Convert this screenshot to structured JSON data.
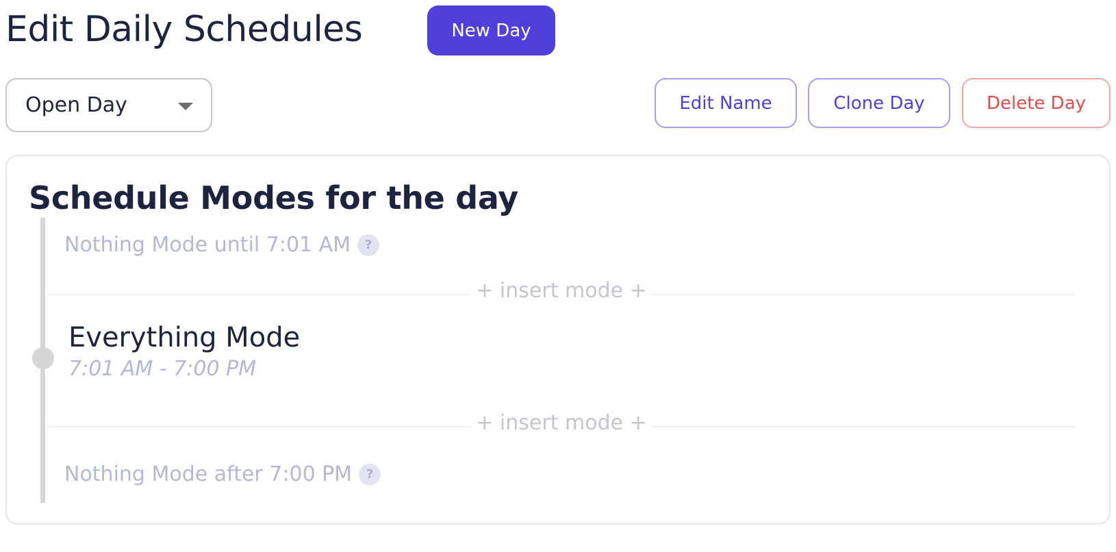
{
  "header": {
    "title": "Edit Daily Schedules",
    "new_day_label": "New Day"
  },
  "toolbar": {
    "day_select": {
      "selected": "Open Day",
      "options": [
        "Open Day"
      ]
    },
    "edit_name_label": "Edit Name",
    "clone_day_label": "Clone Day",
    "delete_day_label": "Delete Day"
  },
  "modes_card": {
    "title": "Schedule Modes for the day",
    "before_text": "Nothing Mode until 7:01 AM",
    "insert_label": "+ insert mode +",
    "modes": [
      {
        "name": "Everything Mode",
        "time_range": "7:01 AM - 7:00 PM"
      }
    ],
    "after_text": "Nothing Mode after 7:00 PM",
    "help_glyph": "?"
  },
  "colors": {
    "primary": "#4f40db",
    "danger": "#e24c4c",
    "muted_text": "#b4b8d4",
    "heading_text": "#1d2440"
  }
}
